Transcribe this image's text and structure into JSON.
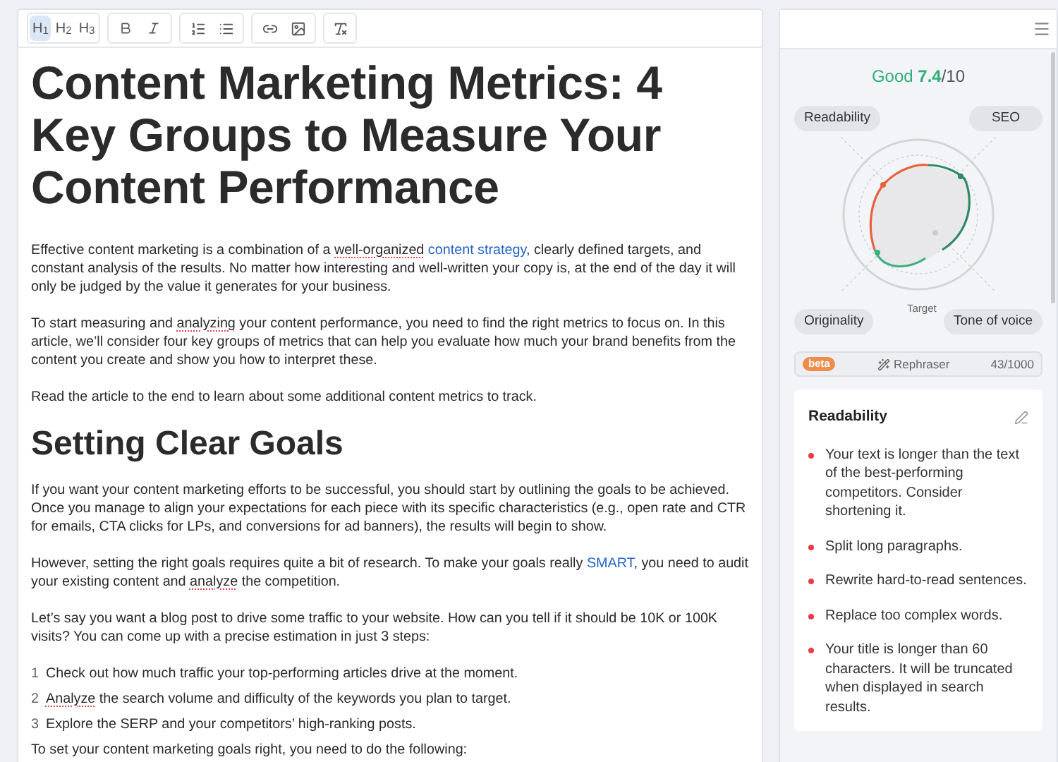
{
  "toolbar": {
    "headings": [
      {
        "label": "H$_{1}$",
        "selected": true
      },
      {
        "label": "H$_{2}$",
        "selected": false
      },
      {
        "label": "H$_{3}$",
        "selected": false
      }
    ]
  },
  "article": {
    "title": "Content Marketing Metrics: 4 Key Groups to Measure Your Content Performance",
    "blocks": [
      {
        "kind": "paragraph",
        "parts": [
          {
            "kind": "text",
            "text": "Effective content marketing is a combination of a "
          },
          {
            "kind": "misspelled",
            "text": "well-organized"
          },
          {
            "kind": "link",
            "text": "content strategy"
          },
          {
            "kind": "text",
            "text": ", clearly defined targets, and constant analysis of the results. No matter how interesting and well-written your copy is, at the end of the day it will only be judged by the value it generates for your business."
          }
        ]
      },
      {
        "kind": "paragraph",
        "parts": [
          {
            "kind": "text",
            "text": "To start measuring and "
          },
          {
            "kind": "misspelled",
            "text": "analyzing"
          },
          {
            "kind": "text",
            "text": " your content performance, you need to find the right metrics to focus on. In this article, we’ll consider four key groups of metrics that can help you evaluate how much your brand benefits from the content you create and show you how to interpret these."
          }
        ]
      },
      {
        "kind": "paragraph",
        "parts": [
          {
            "kind": "text",
            "text": "Read the article to the end to learn about some additional content metrics to track."
          }
        ]
      },
      {
        "kind": "heading",
        "text": "Setting Clear Goals"
      },
      {
        "kind": "paragraph",
        "parts": [
          {
            "kind": "text",
            "text": "If you want your content marketing efforts to be successful, you should start by outlining the goals to be achieved. Once you manage to align your expectations for each piece with its specific characteristics (e.g., open rate and CTR for emails, CTA clicks for LPs, and conversions for ad banners), the results will begin to show."
          }
        ]
      },
      {
        "kind": "paragraph",
        "parts": [
          {
            "kind": "text",
            "text": "However, setting the right goals requires quite a bit of research. To make your goals really "
          },
          {
            "kind": "link",
            "text": "SMART"
          },
          {
            "kind": "text",
            "text": ", you need to audit your existing content and "
          },
          {
            "kind": "misspelled",
            "text": "analyze"
          },
          {
            "kind": "text",
            "text": " the competition."
          }
        ]
      },
      {
        "kind": "paragraph",
        "parts": [
          {
            "kind": "text",
            "text": "Let’s say you want a blog post to drive some traffic to your website. How can you tell if it should be 10K or 100K visits? You can come up with a precise estimation in just 3 steps:"
          }
        ]
      },
      {
        "kind": "list",
        "items": [
          {
            "number": "1",
            "parts": [
              {
                "kind": "text",
                "text": "Check out how much traffic your top-performing articles drive at the moment."
              }
            ]
          },
          {
            "number": "2",
            "parts": [
              {
                "kind": "misspelled",
                "text": "Analyze"
              },
              {
                "kind": "text",
                "text": " the search volume and difficulty of the keywords you plan to target."
              }
            ]
          },
          {
            "number": "3",
            "parts": [
              {
                "kind": "text",
                "text": "Explore the SERP and your competitors’ high-ranking posts."
              }
            ]
          }
        ]
      },
      {
        "kind": "tight-paragraph",
        "parts": [
          {
            "kind": "text",
            "text": "To set your content marketing goals right, you need to do the following:"
          }
        ]
      }
    ]
  },
  "sidebar": {
    "score": {
      "label": "Good",
      "value": "7.4",
      "max": "/10"
    },
    "radar_labels": [
      "Readability",
      "SEO",
      "Originality",
      "Tone of voice"
    ],
    "radar_target": "Target",
    "rephraser": {
      "badge": "beta",
      "label": "Rephraser",
      "count": "43/1000"
    },
    "card": {
      "title": "Readability",
      "items": [
        "Your text is longer than the text of the best-performing competitors. Consider shortening it.",
        "Split long paragraphs.",
        "Rewrite hard-to-read sentences.",
        "Replace too complex words.",
        "Your title is longer than 60 characters. It will be truncated when displayed in search results."
      ]
    }
  }
}
